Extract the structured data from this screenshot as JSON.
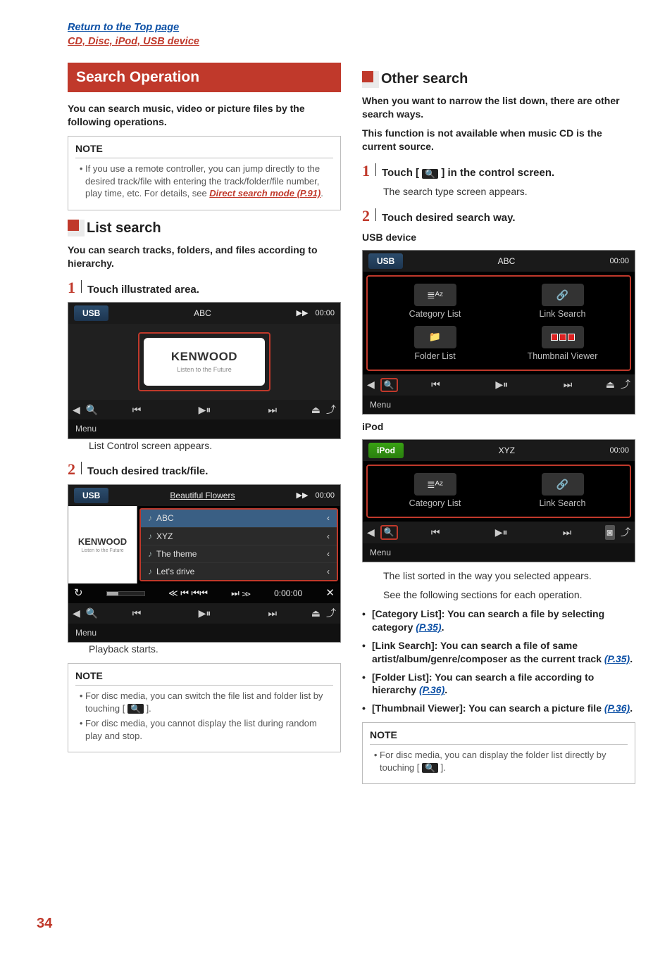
{
  "topnav": {
    "top_link": "Return to the Top page",
    "breadcrumb": "CD, Disc, iPod, USB device"
  },
  "left": {
    "h2": "Search Operation",
    "intro": "You can search music, video or picture files by the following operations.",
    "note1": {
      "title": "NOTE",
      "items": [
        {
          "text_prefix": "If you use a remote controller, you can jump directly to the desired track/file with entering the track/folder/file number, play time, etc. For details, see ",
          "link_text": "Direct search mode (P.91)",
          "text_suffix": "."
        }
      ]
    },
    "h3_list_search": "List search",
    "intro2": "You can search tracks, folders, and files according to hierarchy.",
    "step1": {
      "num": "1",
      "text": "Touch illustrated area."
    },
    "scr1": {
      "tab": "USB",
      "title": "ABC",
      "next_icon": "▶▶",
      "time": "00:00",
      "art_title": "KENWOOD",
      "art_sub": "Listen to the Future",
      "prev": "◀",
      "mag_icon": "🔍",
      "skipprev": "⏮",
      "play": "▶⏸",
      "skipnext": "⏭",
      "eject": "⏏",
      "menu": "Menu"
    },
    "step1_after": "List Control screen appears.",
    "step2": {
      "num": "2",
      "text": "Touch desired track/file."
    },
    "scr2": {
      "tab": "USB",
      "title": "Beautiful Flowers",
      "next_icon": "▶▶",
      "time": "00:00",
      "side_title": "KENWOOD",
      "side_sub": "Listen to the Future",
      "tracks": [
        "ABC",
        "XYZ",
        "The theme",
        "Let's drive"
      ],
      "loop": "↻",
      "navprev": "≪ ⏮ ⏮⏮",
      "navnext": "⏭ ≫",
      "elapsed": "0:00:00",
      "shuffle": "✕",
      "prev": "◀",
      "mag_icon": "🔍",
      "skipprev": "⏮",
      "play": "▶⏸",
      "skipnext": "⏭",
      "eject": "⏏",
      "menu": "Menu"
    },
    "step2_after": "Playback starts.",
    "note2": {
      "title": "NOTE",
      "items": [
        {
          "text_prefix": "For disc media, you can switch the file list and folder list by touching [ ",
          "icon": "🔍",
          "text_suffix": " ]."
        },
        {
          "text_prefix": "For disc media, you cannot display the list during random play and stop."
        }
      ]
    }
  },
  "right": {
    "h3_other": "Other search",
    "intro1": "When you want to narrow the list down, there are other search ways.",
    "intro2": "This function is not available when music CD is the current source.",
    "step1": {
      "num": "1",
      "text_prefix": "Touch [ ",
      "icon": "🔍",
      "text_suffix": " ] in the control screen."
    },
    "step1_after": "The search type screen appears.",
    "step2": {
      "num": "2",
      "text": "Touch desired search way."
    },
    "usb_label": "USB device",
    "scr_usb": {
      "tab": "USB",
      "title": "ABC",
      "time": "00:00",
      "tiles": [
        {
          "label": "Category List",
          "icon": "≣ᴬᶻ"
        },
        {
          "label": "Link Search",
          "icon": "🔗"
        },
        {
          "label": "Folder List",
          "icon": "📁"
        },
        {
          "label": "Thumbnail Viewer",
          "icon": "▦"
        }
      ],
      "prev": "◀",
      "mag_icon": "🔍",
      "skipprev": "⏮",
      "play": "▶⏸",
      "skipnext": "⏭",
      "eject": "⏏",
      "menu": "Menu"
    },
    "ipod_label": "iPod",
    "scr_ipod": {
      "tab": "iPod",
      "title": "XYZ",
      "time": "00:00",
      "tiles": [
        {
          "label": "Category List",
          "icon": "≣ᴬᶻ"
        },
        {
          "label": "Link Search",
          "icon": "🔗"
        }
      ],
      "prev": "◀",
      "mag_icon": "🔍",
      "skipprev": "⏮",
      "play": "▶⏸",
      "skipnext": "⏭",
      "trackicon": "◙",
      "menu": "Menu"
    },
    "after_list1": "The list sorted in the way you selected appears.",
    "after_list2": "See the following sections for each operation.",
    "bullets": [
      {
        "prefix": "[Category List]: You can search a file by selecting category ",
        "link": "(P.35)",
        "suffix": "."
      },
      {
        "prefix": "[Link Search]: You can search a file of same artist/album/genre/composer as the current track ",
        "link": "(P.35)",
        "suffix": "."
      },
      {
        "prefix": "[Folder List]: You can search a file according to hierarchy ",
        "link": "(P.36)",
        "suffix": "."
      },
      {
        "prefix": "[Thumbnail Viewer]: You can search a picture file ",
        "link": "(P.36)",
        "suffix": "."
      }
    ],
    "note": {
      "title": "NOTE",
      "items": [
        {
          "text_prefix": "For disc media, you can display the folder list directly by touching [ ",
          "icon": "🔍",
          "text_suffix": " ]."
        }
      ]
    }
  },
  "pagenum": "34"
}
